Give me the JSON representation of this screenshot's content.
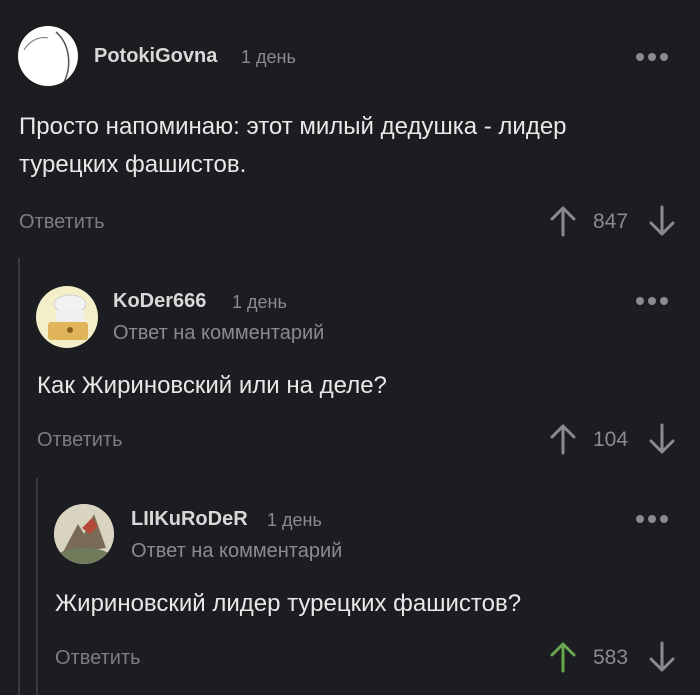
{
  "comments": [
    {
      "author": "PotokiGovna",
      "time": "1 день",
      "text": "Просто напоминаю: этот милый дедушка - лидер турецких фашистов.",
      "reply_label": "Ответить",
      "score": "847"
    },
    {
      "author": "KoDer666",
      "time": "1 день",
      "reply_to": "Ответ на комментарий",
      "text": "Как Жириновский или на деле?",
      "reply_label": "Ответить",
      "score": "104"
    },
    {
      "author": "LIIKuRoDeR",
      "time": "1 день",
      "reply_to": "Ответ на комментарий",
      "text": "Жириновский лидер турецких фашистов?",
      "reply_label": "Ответить",
      "score": "583"
    }
  ],
  "colors": {
    "background": "#1c1d20",
    "upvoted": "#6aa84f",
    "neutral": "#8a8b8f"
  },
  "icons": {
    "up": "arrow-up-icon",
    "down": "arrow-down-icon",
    "more": "more-dots-icon"
  }
}
